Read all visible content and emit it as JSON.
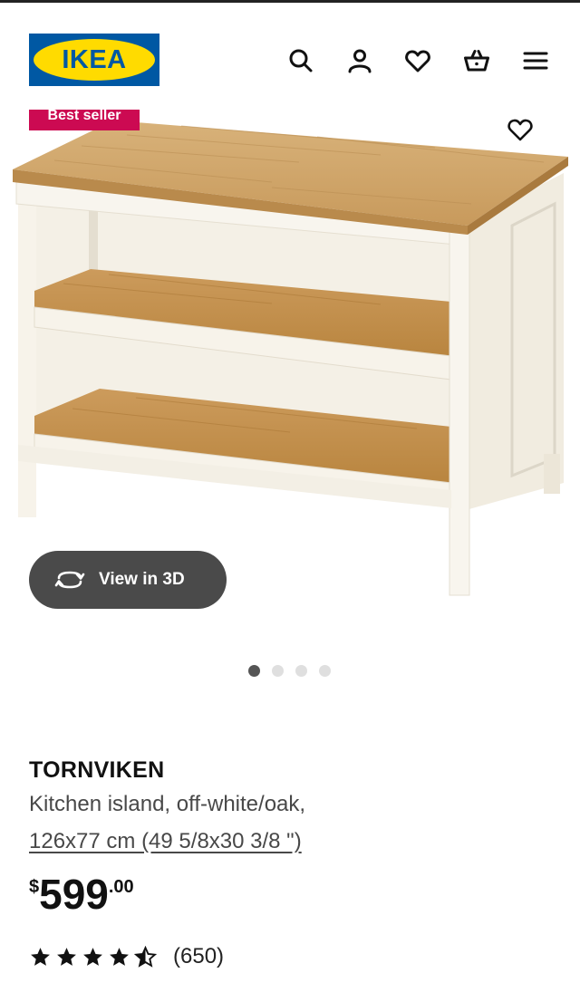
{
  "header": {
    "logo_text": "IKEA",
    "icons": [
      "search-icon",
      "account-icon",
      "favourites-icon",
      "cart-icon",
      "menu-icon"
    ]
  },
  "hero": {
    "badge": "Best seller",
    "view3d_label": "View in 3D",
    "dots_total": 4,
    "dots_active": 1
  },
  "product": {
    "name": "TORNVIKEN",
    "description": "Kitchen island, off-white/oak,",
    "size": "126x77 cm (49 5/8x30 3/8 \")",
    "price_currency": "$",
    "price_whole": "599",
    "price_cents": ".00",
    "rating_stars": 4.5,
    "review_count": "(650)"
  },
  "colors": {
    "ikea_blue": "#0058a3",
    "ikea_yellow": "#ffdb00",
    "badge_red": "#cc0a52",
    "button_dark": "#4a4a4a"
  }
}
